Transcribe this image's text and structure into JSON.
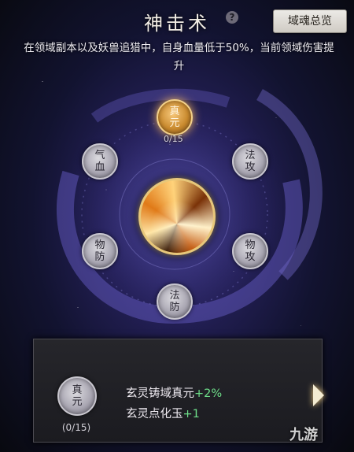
{
  "header": {
    "title": "神击术",
    "help_icon": "question-icon",
    "help_glyph": "?",
    "overview_button": "域魂总览"
  },
  "description": "在领域副本以及妖兽追猎中，自身血量低于50%，当前领域伤害提升",
  "nodes": {
    "top": {
      "label": "真元",
      "count": "0/15",
      "state": "active"
    },
    "upper_left": {
      "label": "气血"
    },
    "upper_right": {
      "label": "法攻"
    },
    "lower_left": {
      "label": "物防"
    },
    "lower_right": {
      "label": "物攻"
    },
    "bottom": {
      "label": "法防"
    }
  },
  "center_icon": "flame-burst-icon",
  "detail_panel": {
    "node_label": "真元",
    "count": "(0/15)",
    "attributes": [
      {
        "name": "玄灵铸域真元",
        "bonus": "+2%"
      },
      {
        "name": "玄灵点化玉",
        "bonus": "+1"
      }
    ]
  },
  "watermark": "九游",
  "colors": {
    "active_node": "#e0a040",
    "bonus_text": "#6fe08a",
    "center_ring": "#e7c77a"
  }
}
